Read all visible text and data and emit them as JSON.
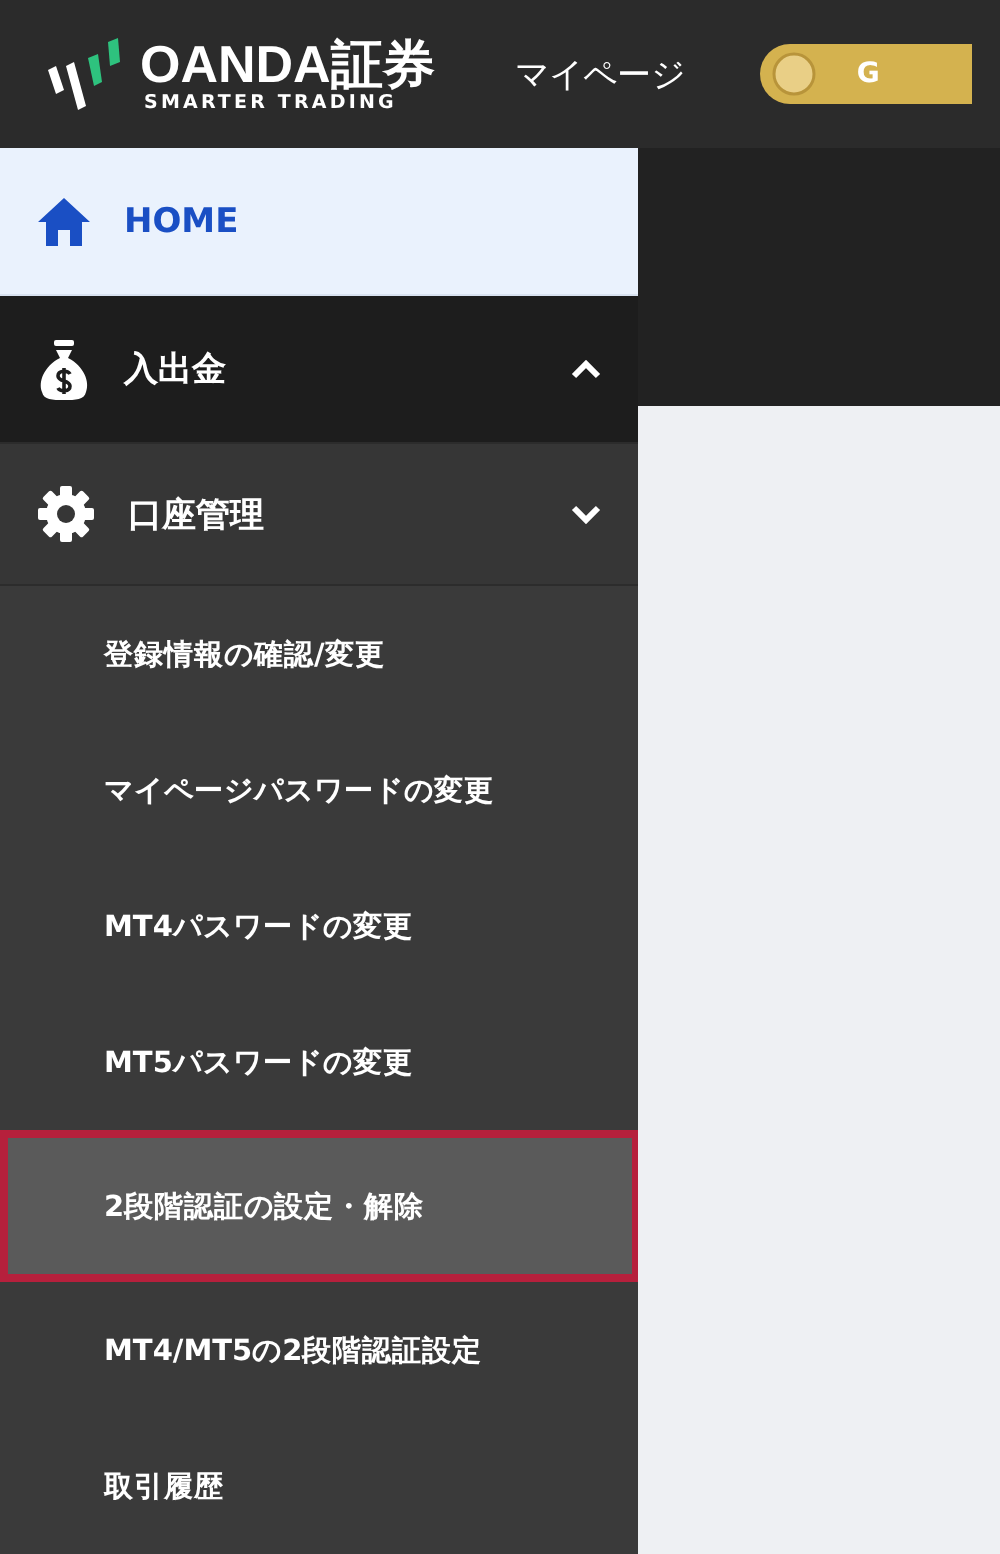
{
  "header": {
    "logo_name": "OANDA証券",
    "logo_tagline": "SMARTER TRADING",
    "mypage_link": "マイページ",
    "badge_text": "G"
  },
  "nav": [
    {
      "kind": "home",
      "label": "HOME",
      "selected": true
    },
    {
      "kind": "deposit",
      "label": "入出金",
      "selected": false,
      "expanded": true
    },
    {
      "kind": "account",
      "label": "口座管理",
      "selected": false,
      "expanded": false
    }
  ],
  "subitems": [
    {
      "label": "登録情報の確認/変更",
      "selected": false
    },
    {
      "label": "マイページパスワードの変更",
      "selected": false
    },
    {
      "label": "MT4パスワードの変更",
      "selected": false
    },
    {
      "label": "MT5パスワードの変更",
      "selected": false
    },
    {
      "label": "2段階認証の設定・解除",
      "selected": true
    },
    {
      "label": "MT4/MT5の2段階認証設定",
      "selected": false
    },
    {
      "label": "取引履歴",
      "selected": false
    }
  ]
}
